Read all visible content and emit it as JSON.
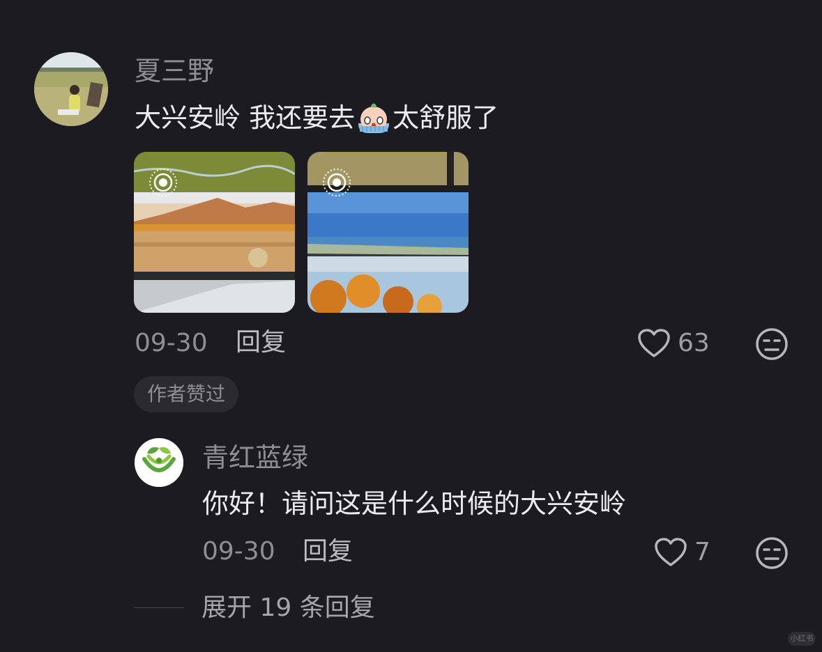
{
  "main_comment": {
    "username": "夏三野",
    "text_before": "大兴安岭 我还要去",
    "emoji": "crying-face-sticker",
    "text_after": "太舒服了",
    "date": "09-30",
    "reply_label": "回复",
    "like_count": "63",
    "author_liked_label": "作者赞过"
  },
  "reply_comment": {
    "username": "青红蓝绿",
    "text": "你好！请问这是什么时候的大兴安岭",
    "date": "09-30",
    "reply_label": "回复",
    "like_count": "7"
  },
  "expand_replies_label": "展开 19 条回复",
  "watermark": "小红书",
  "colors": {
    "background": "#1c1b21",
    "text_primary": "#ececf0",
    "text_secondary": "#8f8e96",
    "pill_background": "#2b2a31"
  }
}
